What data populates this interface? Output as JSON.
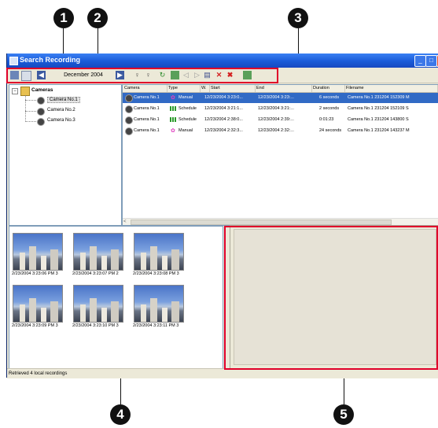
{
  "window": {
    "title": "Search Recording"
  },
  "toolbar": {
    "date": "December 2004"
  },
  "tree": {
    "root": "Cameras",
    "items": [
      "Camera No.1",
      "Camera No.2",
      "Camera No.3"
    ]
  },
  "list": {
    "columns": [
      "Camera",
      "Type",
      "W.",
      "Start",
      "End",
      "Duration",
      "Filename"
    ],
    "rows": [
      {
        "camera": "Camera No.1",
        "type": "Manual",
        "start": "12/23/2004 3:23:0...",
        "end": "12/23/2004 3:23:...",
        "duration": "6 seconds",
        "filename": "Camera No.1 231204 152309 M",
        "selected": true
      },
      {
        "camera": "Camera No.1",
        "type": "Schedule",
        "start": "12/23/2004 3:21:1...",
        "end": "12/23/2004 3:21:...",
        "duration": "2 seconds",
        "filename": "Camera No.1 231204 152109 S",
        "selected": false
      },
      {
        "camera": "Camera No.1",
        "type": "Schedule",
        "start": "12/23/2004 2:38:0...",
        "end": "12/23/2004 2:39:...",
        "duration": "0:01:23",
        "filename": "Camera No.1 231204 143800 S",
        "selected": false
      },
      {
        "camera": "Camera No.1",
        "type": "Manual",
        "start": "12/23/2004 2:32:3...",
        "end": "12/23/2004 2:32:...",
        "duration": "24 seconds",
        "filename": "Camera No.1 231204 143237 M",
        "selected": false
      }
    ]
  },
  "thumbnails": [
    "2/23/2004 3:23:06 PM 3",
    "2/23/2004 3:23:07 PM 2",
    "2/23/2004 3:23:08 PM 3",
    "2/23/2004 3:23:09 PM 3",
    "2/23/2004 3:23:10 PM 3",
    "2/23/2004 3:23:11 PM 3"
  ],
  "status": {
    "text": "Retrieved 4 local recordings"
  },
  "callouts": {
    "c1": "1",
    "c2": "2",
    "c3": "3",
    "c4": "4",
    "c5": "5"
  },
  "colors": {
    "highlight": "#e0002a",
    "selection": "#316ac5",
    "titlebar": "#1a5bd8"
  }
}
